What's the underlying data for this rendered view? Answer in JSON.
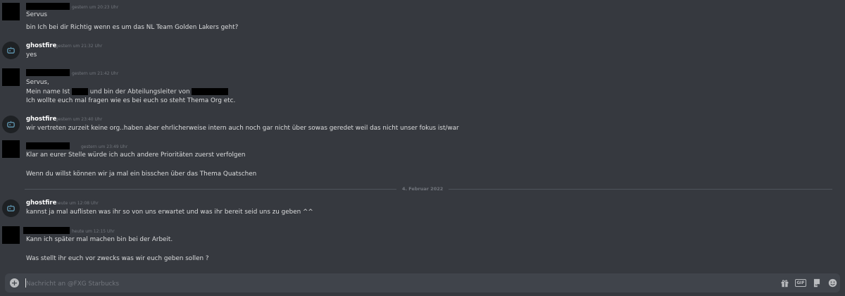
{
  "messages": [
    {
      "author": "",
      "timestamp": "gestern um 20:23 Uhr",
      "lines": [
        "Servus",
        "bin Ich bei dir Richtig wenn es um das NL Team Golden Lakers geht?"
      ]
    },
    {
      "author": "ghostfire",
      "timestamp": "gestern um 21:32 Uhr",
      "lines": [
        "yes"
      ]
    },
    {
      "author": "",
      "timestamp": "gestern um 21:42 Uhr",
      "line1": "Servus,",
      "line2_a": "Mein name Ist",
      "line2_b": "und bin der Abteilungsleiter von",
      "line3": "Ich wollte euch mal fragen wie es bei euch so steht Thema Org etc."
    },
    {
      "author": "ghostfire",
      "timestamp": "gestern um 23:40 Uhr",
      "lines": [
        "wir vertreten zurzeit keine org..haben aber ehrlicherweise intern auch noch gar nicht über sowas geredet weil das nicht unser fokus ist/war"
      ]
    },
    {
      "author": "",
      "timestamp": "gestern um 23:49 Uhr",
      "lines": [
        "Klar an eurer Stelle würde ich auch andere Prioritäten zuerst verfolgen",
        "Wenn du willst können wir ja mal ein bisschen über das Thema Quatschen"
      ]
    },
    {
      "author": "ghostfire",
      "timestamp": "heute um 12:08 Uhr",
      "lines": [
        "kannst ja mal auflisten was ihr so von uns erwartet und was ihr bereit seid uns zu geben ^^"
      ]
    },
    {
      "author": "",
      "timestamp": "heute um 12:15 Uhr",
      "lines": [
        "Kann ich später mal machen bin bei der Arbeit.",
        "Was stellt ihr euch vor zwecks was wir euch geben sollen ?"
      ]
    }
  ],
  "date_divider": "4. Februar 2022",
  "composer": {
    "placeholder": "Nachricht an @FXG Starbucks",
    "value": ""
  },
  "toolbar": {
    "gift_icon": "gift-icon",
    "gif_label": "GIF",
    "sticker_icon": "sticker-icon",
    "emoji_icon": "emoji-icon"
  }
}
